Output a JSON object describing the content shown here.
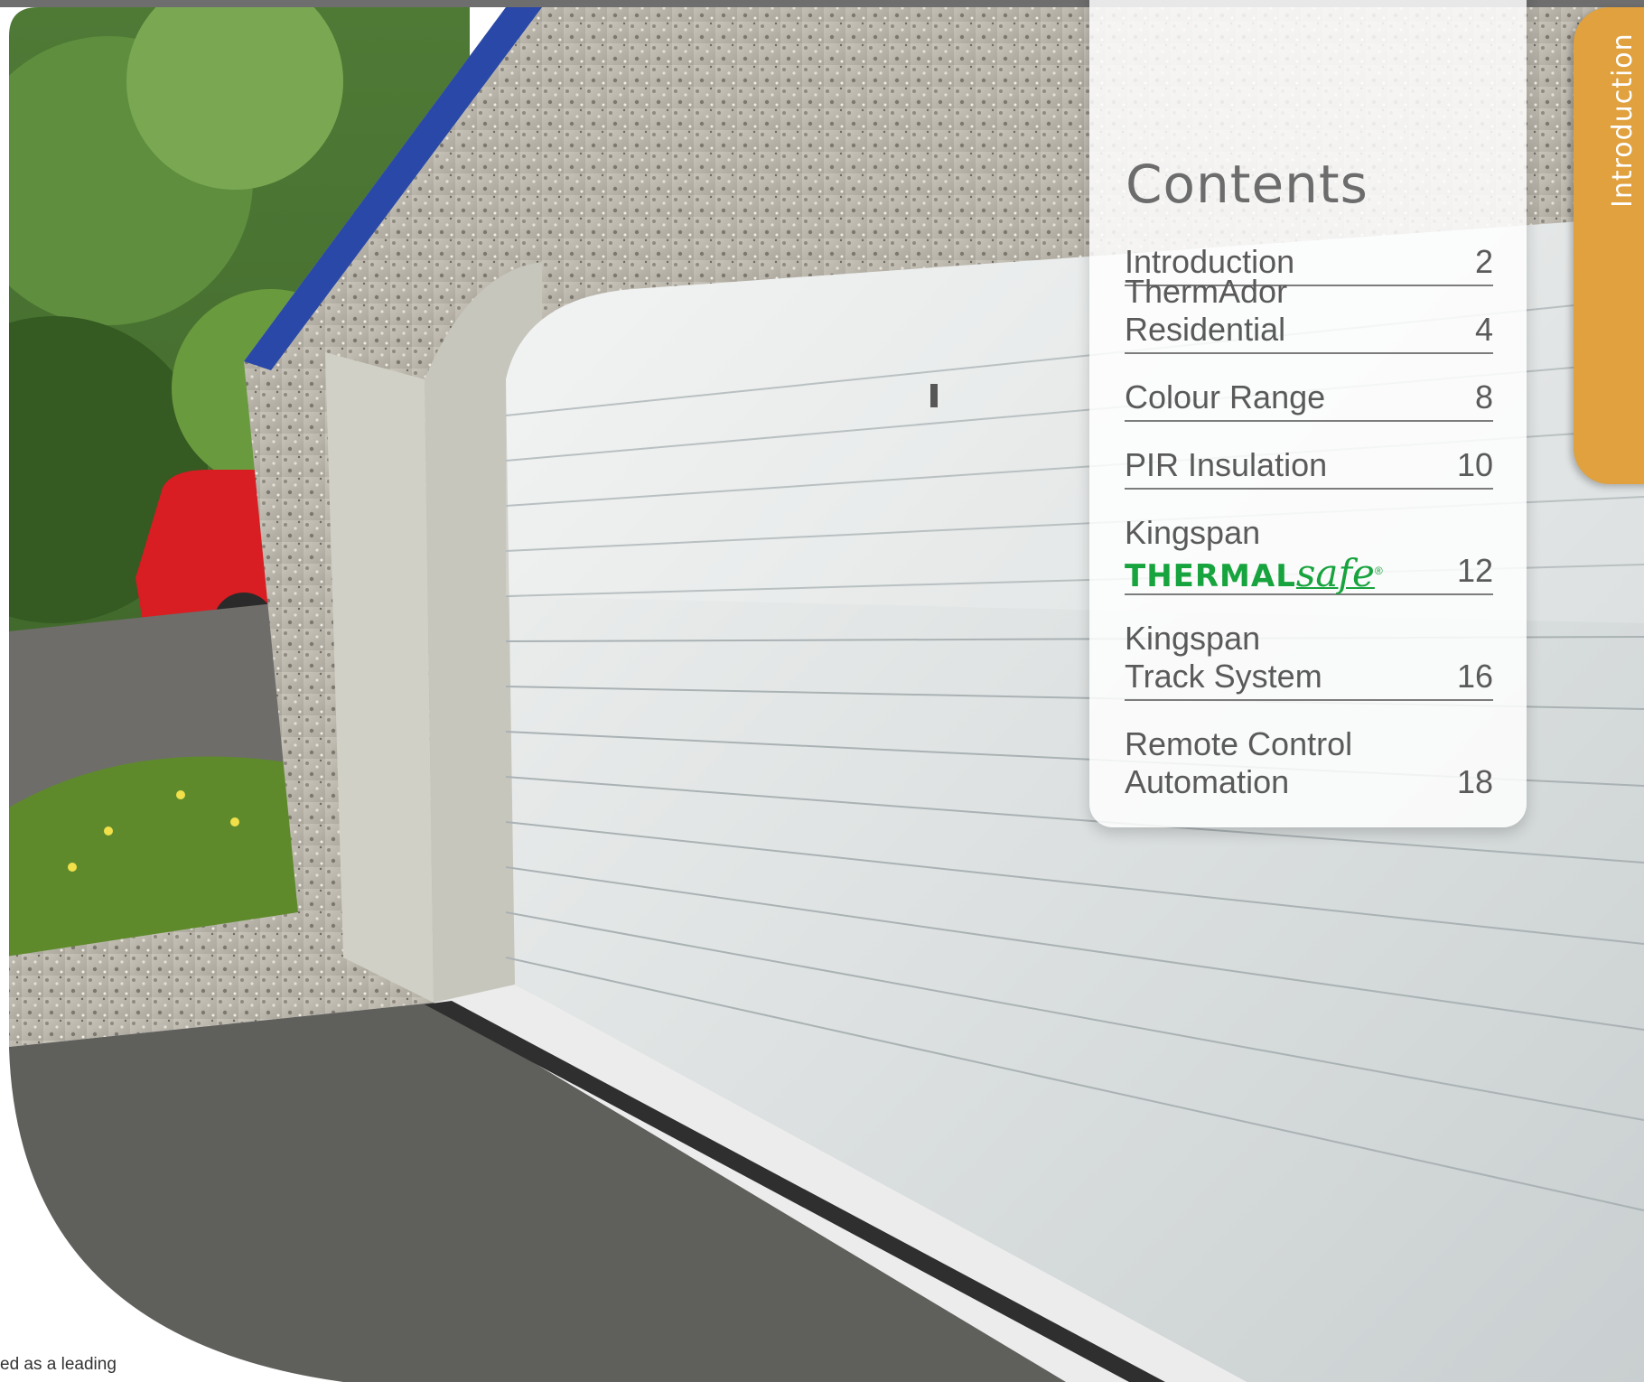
{
  "contents": {
    "title": "Contents",
    "items": [
      {
        "lines": [
          "Introduction"
        ],
        "page": "2"
      },
      {
        "lines": [
          "ThermAdor Residential"
        ],
        "page": "4"
      },
      {
        "lines": [
          "Colour Range"
        ],
        "page": "8"
      },
      {
        "lines": [
          "PIR Insulation"
        ],
        "page": "10"
      },
      {
        "lines": [
          "Kingspan"
        ],
        "page": "12",
        "logo": {
          "bold": "THERMAL",
          "italic": "safe",
          "mark": "®"
        }
      },
      {
        "lines": [
          "Kingspan",
          "Track System"
        ],
        "page": "16"
      },
      {
        "lines": [
          "Remote Control",
          "Automation"
        ],
        "page": "18"
      }
    ]
  },
  "section_tab": {
    "label": "Introduction",
    "color": "#e0a13e"
  },
  "caption_fragment": "ed as a leading",
  "colors": {
    "logo_green": "#17a33d",
    "text_grey": "#5a5a5a"
  }
}
